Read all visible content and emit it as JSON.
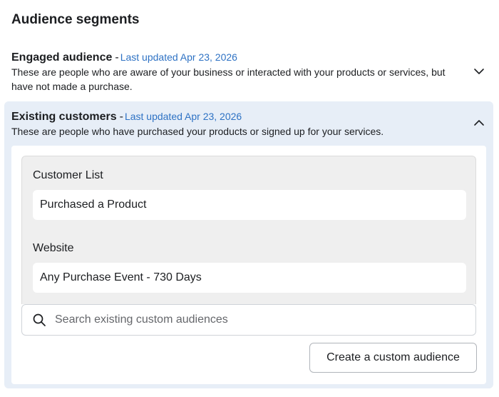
{
  "page": {
    "title": "Audience segments"
  },
  "segments": [
    {
      "name": "Engaged audience",
      "separator": "-",
      "updated": "Last updated Apr 23, 2026",
      "description": "These are people who are aware of your business or interacted with your products or services, but have not made a purchase.",
      "expanded": false,
      "chevron_icon": "chevron-down-icon"
    },
    {
      "name": "Existing customers",
      "separator": "-",
      "updated": "Last updated Apr 23, 2026",
      "description": "These are people who have purchased your products or signed up for your services.",
      "expanded": true,
      "chevron_icon": "chevron-up-icon",
      "groups": [
        {
          "label": "Customer List",
          "item": "Purchased a Product"
        },
        {
          "label": "Website",
          "item": "Any Purchase Event - 730 Days"
        }
      ],
      "search": {
        "placeholder": "Search existing custom audiences",
        "value": "",
        "icon": "search-icon"
      },
      "create_button": "Create a custom audience"
    }
  ],
  "colors": {
    "accent_link": "#2e72c4",
    "expanded_background": "#e7eef7",
    "selected_box_background": "#efefef"
  }
}
